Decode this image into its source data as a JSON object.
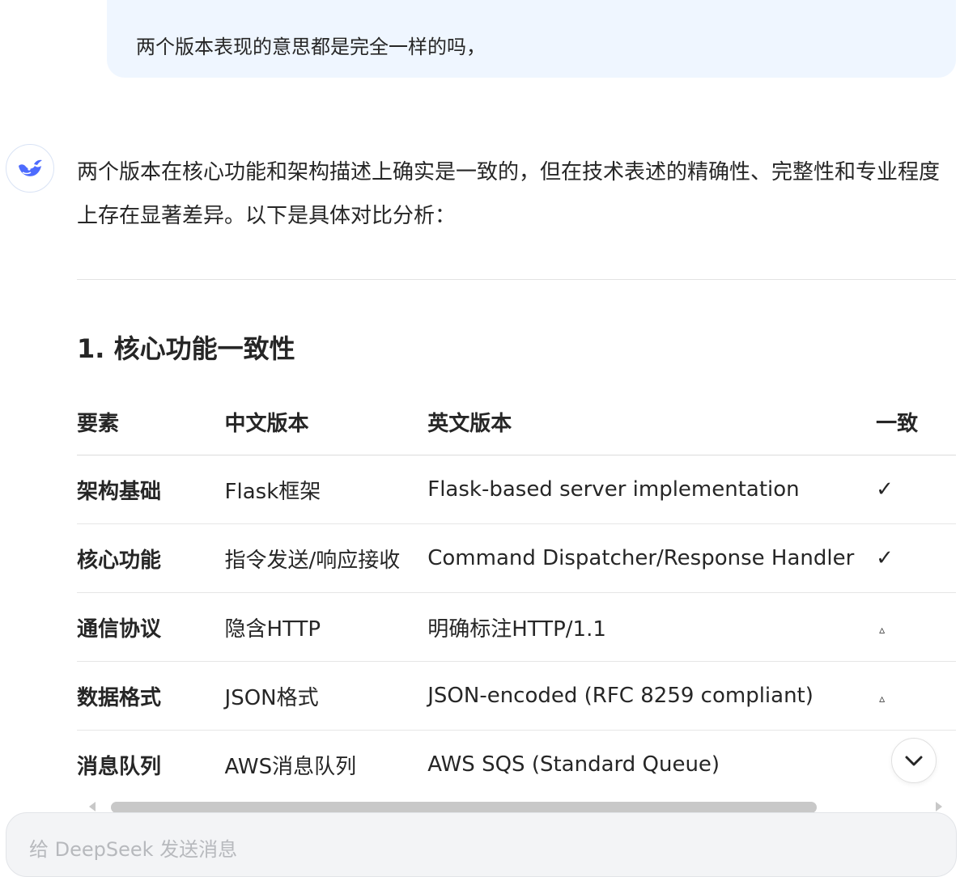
{
  "user_message": {
    "text": "两个版本表现的意思都是完全一样的吗，"
  },
  "assistant": {
    "avatar_icon": "deepseek-whale-icon",
    "intro": "两个版本在核心功能和架构描述上确实是一致的，但在技术表述的精确性、完整性和专业程度上存在显著差异。以下是具体对比分析：",
    "section_heading": "1. 核心功能一致性",
    "table": {
      "headers": [
        "要素",
        "中文版本",
        "英文版本",
        "一致"
      ],
      "rows": [
        {
          "element": "架构基础",
          "zh": "Flask框架",
          "en": "Flask-based server implementation",
          "status": "✓"
        },
        {
          "element": "核心功能",
          "zh": "指令发送/响应接收",
          "en": "Command Dispatcher/Response Handler",
          "status": "✓"
        },
        {
          "element": "通信协议",
          "zh": "隐含HTTP",
          "en": "明确标注HTTP/1.1",
          "status": "▵"
        },
        {
          "element": "数据格式",
          "zh": "JSON格式",
          "en": "JSON-encoded (RFC 8259 compliant)",
          "status": "▵"
        },
        {
          "element": "消息队列",
          "zh": "AWS消息队列",
          "en": "AWS SQS (Standard Queue)",
          "status": ""
        }
      ]
    }
  },
  "scroll_down_icon": "chevron-down-icon",
  "composer": {
    "placeholder": "给 DeepSeek 发送消息"
  },
  "colors": {
    "user_bubble": "#eff6ff",
    "accent": "#4d6bfe"
  }
}
